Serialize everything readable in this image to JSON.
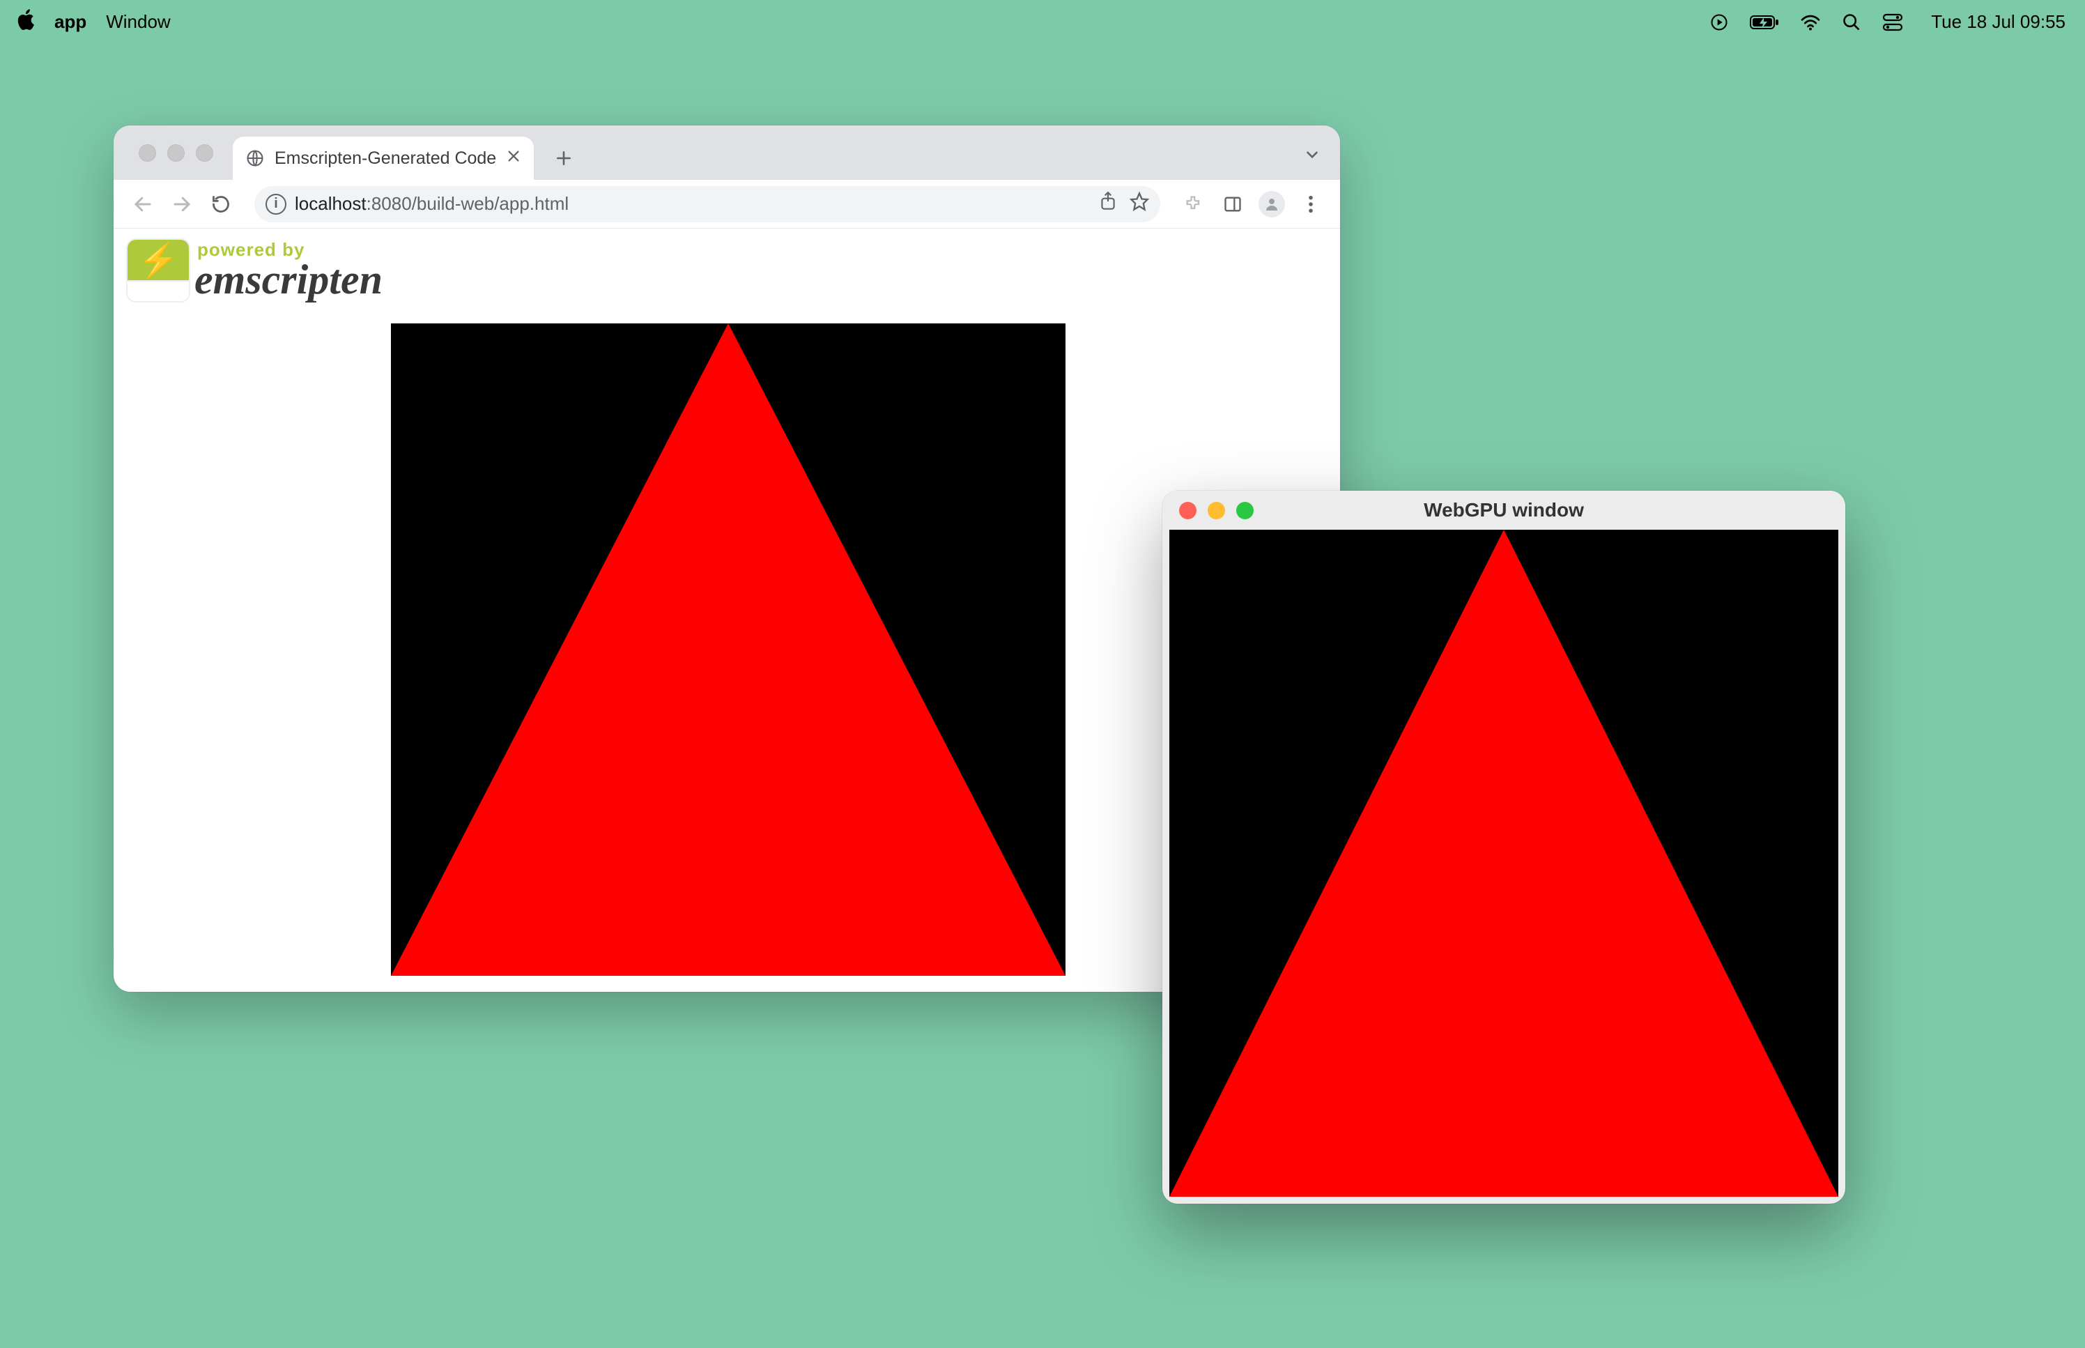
{
  "menubar": {
    "apple_icon": "apple",
    "app_name": "app",
    "menus": [
      "Window"
    ],
    "status_icons": [
      "screen-record-icon",
      "battery-icon",
      "wifi-icon",
      "spotlight-icon",
      "control-center-icon"
    ],
    "clock": "Tue 18 Jul  09:55"
  },
  "browser": {
    "traffic_dimmed": true,
    "tab": {
      "title": "Emscripten-Generated Code"
    },
    "url": {
      "scheme_host": "localhost",
      "rest": ":8080/build-web/app.html"
    },
    "logo": {
      "powered_by": "powered by",
      "name": "emscripten"
    }
  },
  "native": {
    "title": "WebGPU window"
  },
  "rendering": {
    "shape": "triangle",
    "fill": "#ff0000",
    "background": "#000000"
  }
}
